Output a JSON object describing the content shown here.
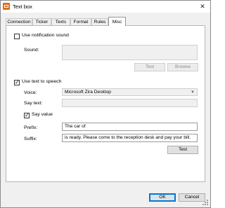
{
  "window": {
    "title": "Text box",
    "close_glyph": "✕"
  },
  "tabs": [
    {
      "label": "Connection"
    },
    {
      "label": "Ticker"
    },
    {
      "label": "Texts"
    },
    {
      "label": "Format"
    },
    {
      "label": "Rules"
    },
    {
      "label": "Misc",
      "active": true
    }
  ],
  "notification": {
    "checkbox_label": "Use notification sound",
    "checked": false,
    "sound_label": "Sound:",
    "sound_value": "",
    "test_button": "Test",
    "browse_button": "Browse"
  },
  "tts": {
    "checkbox_label": "Use text to speech",
    "checked": true,
    "voice_label": "Voice:",
    "voice_value": "Microsoft Zira Desktop",
    "say_text_label": "Say text:",
    "say_text_value": "",
    "say_value_label": "Say value",
    "say_value_checked": true,
    "prefix_label": "Prefix:",
    "prefix_value": "The car of",
    "suffix_label": "Suffix:",
    "suffix_value": "is ready. Please come to the reception desk and pay your bill.",
    "test_button": "Test"
  },
  "footer": {
    "ok_button": "OK",
    "cancel_button": "Cancel"
  }
}
